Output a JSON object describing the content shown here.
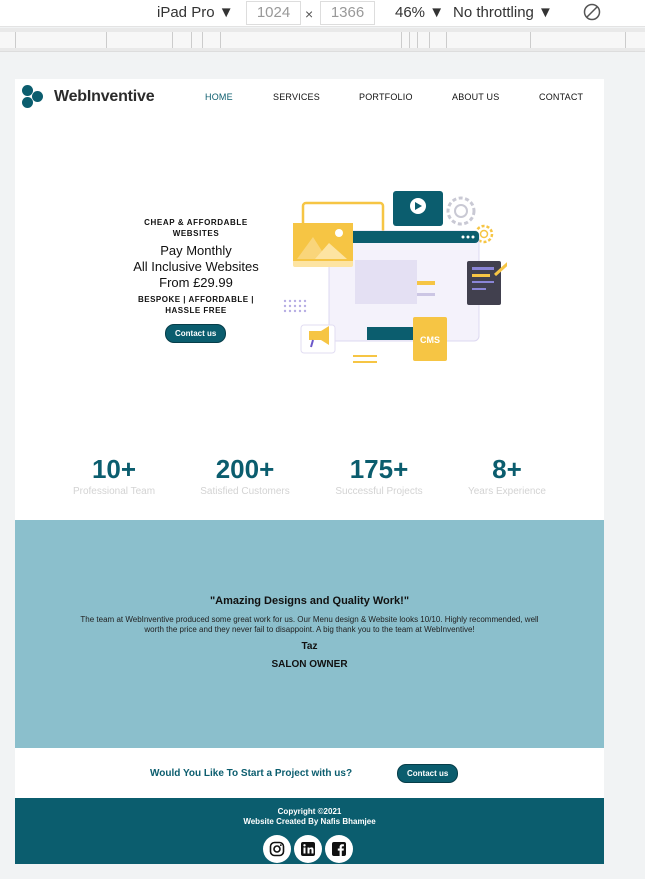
{
  "devtools": {
    "device": "iPad Pro",
    "width": "1024",
    "height": "1366",
    "times": "×",
    "zoom": "46%",
    "throttle": "No throttling",
    "caret": "▼"
  },
  "nav": {
    "brand": "WebInventive",
    "items": [
      "HOME",
      "SERVICES",
      "PORTFOLIO",
      "ABOUT US",
      "CONTACT"
    ]
  },
  "hero": {
    "kicker": "CHEAP & AFFORDABLE WEBSITES",
    "line1": "Pay Monthly",
    "line2": "All Inclusive Websites",
    "line3": "From £29.99",
    "sub": "BESPOKE | AFFORDABLE | HASSLE FREE",
    "button": "Contact us",
    "illustration_badge": "CMS"
  },
  "stats": [
    {
      "num": "10+",
      "label": "Professional Team"
    },
    {
      "num": "200+",
      "label": "Satisfied Customers"
    },
    {
      "num": "175+",
      "label": "Successful Projects"
    },
    {
      "num": "8+",
      "label": "Years Experience"
    }
  ],
  "testimonial": {
    "title": "\"Amazing Designs and Quality Work!\"",
    "body": "The team at WebInventive produced some great work for us. Our Menu design & Website looks 10/10. Highly recommended, well worth the price and they never fail to disappoint. A big thank you to the team at WebInventive!",
    "name": "Taz",
    "role": "SALON OWNER"
  },
  "cta": {
    "text": "Would You Like To Start a Project with us?",
    "button": "Contact us"
  },
  "footer": {
    "copyright": "Copyright ©2021",
    "credit": "Website Created By Nafis Bhamjee",
    "socials": [
      "instagram-icon",
      "linkedin-icon",
      "facebook-icon"
    ]
  },
  "colors": {
    "brand": "#0b5d6e",
    "testimonial_bg": "#8bbfcc",
    "accent_yellow": "#f6c544"
  }
}
